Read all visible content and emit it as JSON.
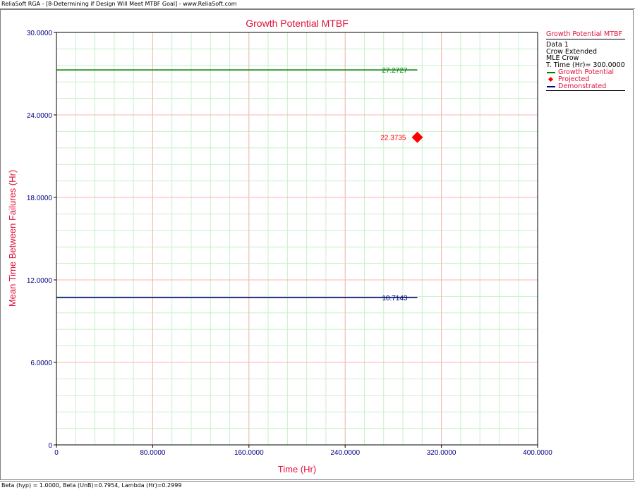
{
  "window": {
    "title": "ReliaSoft RGA - [8-Determining if Design Will Meet MTBF Goal] - www.ReliaSoft.com"
  },
  "status_bar": {
    "text": "Beta (hyp) = 1.0000, Beta (UnB)=0.7954, Lambda (Hr)=0.2999"
  },
  "colors": {
    "title_red": "#e0103a",
    "axis_blue": "#000080",
    "grid_major": "#ffb3b3",
    "grid_minor": "#c8f0c8",
    "growth_green": "#008000",
    "projected_red": "#ff0000",
    "demonstrated_navy": "#000080"
  },
  "legend": {
    "title": "Growth Potential MTBF",
    "info": [
      "Data 1",
      "Crow Extended",
      "MLE Crow",
      "T. Time (Hr)= 300.0000"
    ],
    "entries": [
      {
        "label": "Growth Potential",
        "marker": "line",
        "color": "#008000"
      },
      {
        "label": "Projected",
        "marker": "diamond",
        "color": "#ff0000"
      },
      {
        "label": "Demonstrated",
        "marker": "line",
        "color": "#000080"
      }
    ]
  },
  "chart_data": {
    "type": "line",
    "title": "Growth Potential MTBF",
    "xlabel": "Time (Hr)",
    "ylabel": "Mean Time Between Failures (Hr)",
    "xlim": [
      0,
      400
    ],
    "ylim": [
      0,
      30
    ],
    "x_ticks": [
      0,
      80,
      160,
      240,
      320,
      400
    ],
    "x_tick_labels": [
      "0",
      "80.0000",
      "160.0000",
      "240.0000",
      "320.0000",
      "400.0000"
    ],
    "y_ticks": [
      0,
      6,
      12,
      18,
      24,
      30
    ],
    "y_tick_labels": [
      "0",
      "6.0000",
      "12.0000",
      "18.0000",
      "24.0000",
      "30.0000"
    ],
    "grid": true,
    "legend_position": "right",
    "series": [
      {
        "name": "Growth Potential",
        "kind": "line",
        "x": [
          0,
          300
        ],
        "y": [
          27.2727,
          27.2727
        ],
        "label": "27.2727",
        "color": "#008000"
      },
      {
        "name": "Projected",
        "kind": "point",
        "x": [
          300
        ],
        "y": [
          22.3735
        ],
        "label": "22.3735",
        "color": "#ff0000"
      },
      {
        "name": "Demonstrated",
        "kind": "line",
        "x": [
          0,
          300
        ],
        "y": [
          10.7143,
          10.7143
        ],
        "label": "10.7143",
        "color": "#000080"
      }
    ]
  }
}
